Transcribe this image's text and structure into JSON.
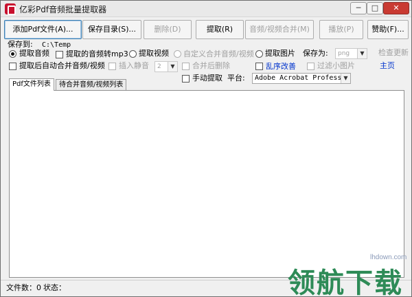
{
  "window": {
    "title": "亿彩Pdf音频批量提取器"
  },
  "titlebar_buttons": {
    "minimize": "─",
    "maximize": "□",
    "close": "✕"
  },
  "toolbar": {
    "add_pdf": "添加Pdf文件(A)...",
    "save_dir": "保存目录(S)...",
    "delete": "删除(D)",
    "extract": "提取(R)",
    "merge_av": "音频/视频合并(M)",
    "play": "播放(P)",
    "help": "赞助(F)..."
  },
  "options": {
    "save_to_label": "保存到:",
    "save_to_path": "C:\\Temp",
    "extract_audio": "提取音频",
    "audio_to_mp3": "提取的音频转mp3",
    "extract_video": "提取视频",
    "custom_merge": "自定义合并音频/视频",
    "extract_image": "提取图片",
    "save_as_label": "保存为:",
    "save_as_value": "png",
    "check_update": "检查更新",
    "auto_merge": "提取后自动合并音频/视频",
    "insert_silence": "插入静音",
    "silence_value": "2",
    "delete_after_merge": "合并后删除",
    "shuffle": "乱序改善",
    "filter_small": "过滤小图片",
    "homepage": "主页",
    "manual_extract": "手动提取",
    "platform_label": "平台:",
    "platform_value": "Adobe Acrobat Professional"
  },
  "tabs": [
    "Pdf文件列表",
    "待合并音频/视频列表"
  ],
  "status": {
    "file_count": "文件数：0",
    "state": "状态："
  },
  "watermark": {
    "url": "lhdown.com",
    "text": "领航下载"
  },
  "colors": {
    "link": "#0033cc",
    "disabled": "#a0a0a0",
    "close": "#c93a32",
    "watermark": "#2e8b57"
  }
}
